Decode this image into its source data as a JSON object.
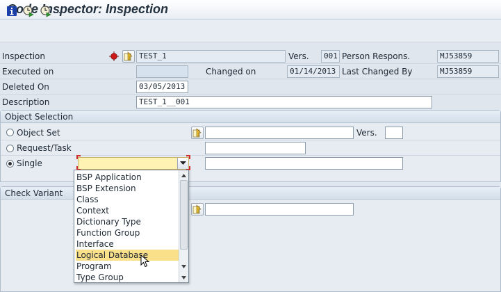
{
  "window": {
    "title": "Code Inspector: Inspection"
  },
  "toolbar": {
    "more": "..."
  },
  "header": {
    "inspection_label": "Inspection",
    "inspection_value": "TEST_1",
    "vers_label": "Vers.",
    "vers_value": "001",
    "person_label": "Person Respons.",
    "person_value": "MJ53859",
    "executed_label": "Executed on",
    "executed_value": "",
    "changed_label": "Changed on",
    "changed_value": "01/14/2013",
    "last_changed_label": "Last Changed By",
    "last_changed_value": "MJ53859",
    "deleted_label": "Deleted On",
    "deleted_value": "03/05/2013",
    "description_label": "Description",
    "description_value": "TEST_1__001"
  },
  "object_selection": {
    "title": "Object Selection",
    "object_set_label": "Object Set",
    "object_set_vers_label": "Vers.",
    "request_label": "Request/Task",
    "single_label": "Single",
    "selected": "single"
  },
  "check_variant": {
    "title": "Check Variant"
  },
  "dropdown": {
    "options": [
      "BSP Application",
      "BSP Extension",
      "Class",
      "Context",
      "Dictionary Type",
      "Function Group",
      "Interface",
      "Logical Database",
      "Program",
      "Type Group"
    ],
    "highlighted": "Logical Database"
  },
  "colors": {
    "background": "#dfe6ee",
    "highlight": "#fbe08a",
    "combo_bg": "#fff2b3",
    "status_red": "#d01818"
  }
}
